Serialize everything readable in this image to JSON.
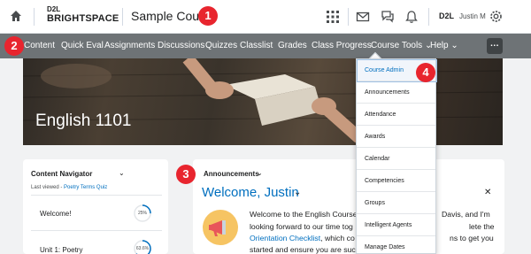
{
  "header": {
    "logo_line1": "D2L",
    "logo_line2": "BRIGHTSPACE",
    "course_title": "Sample Course",
    "brand_mini": "D2L",
    "user_name": "Justin M"
  },
  "callouts": [
    "1",
    "2",
    "3",
    "4"
  ],
  "navbar": {
    "items": [
      "Content",
      "Quick Eval",
      "Assignments",
      "Discussions",
      "Quizzes",
      "Classlist",
      "Grades",
      "Class Progress",
      "Course Tools",
      "Help"
    ],
    "more_label": "..."
  },
  "banner": {
    "course_name": "English 1101"
  },
  "content_navigator": {
    "title": "Content Navigator",
    "last_viewed_label": "Last viewed - ",
    "last_viewed_link": "Poetry Terms Quiz",
    "items": [
      {
        "label": "Welcome!",
        "progress": "25%",
        "fraction": 0.25
      },
      {
        "label": "Unit 1: Poetry",
        "progress": "63.6%",
        "fraction": 0.636
      }
    ]
  },
  "announcements": {
    "title": "Announcements",
    "welcome": "Welcome, Justin",
    "line1": "Welcome to the English Course",
    "line1_end": "Davis, and I'm",
    "line2": "looking forward to our time tog",
    "line2_end": "lete the",
    "line3_link": "Orientation Checklist",
    "line3_rest": ", which co",
    "line3_end": "ns to get you",
    "line4": "started and ensure you are suc"
  },
  "course_tools_menu": {
    "items": [
      "Course Admin",
      "Announcements",
      "Attendance",
      "Awards",
      "Calendar",
      "Competencies",
      "Groups",
      "Intelligent Agents",
      "Manage Dates"
    ]
  },
  "colors": {
    "callout": "#e8252e",
    "navbar": "#6e7376",
    "link": "#006fbf",
    "megaphone_bg": "#f6c463"
  }
}
